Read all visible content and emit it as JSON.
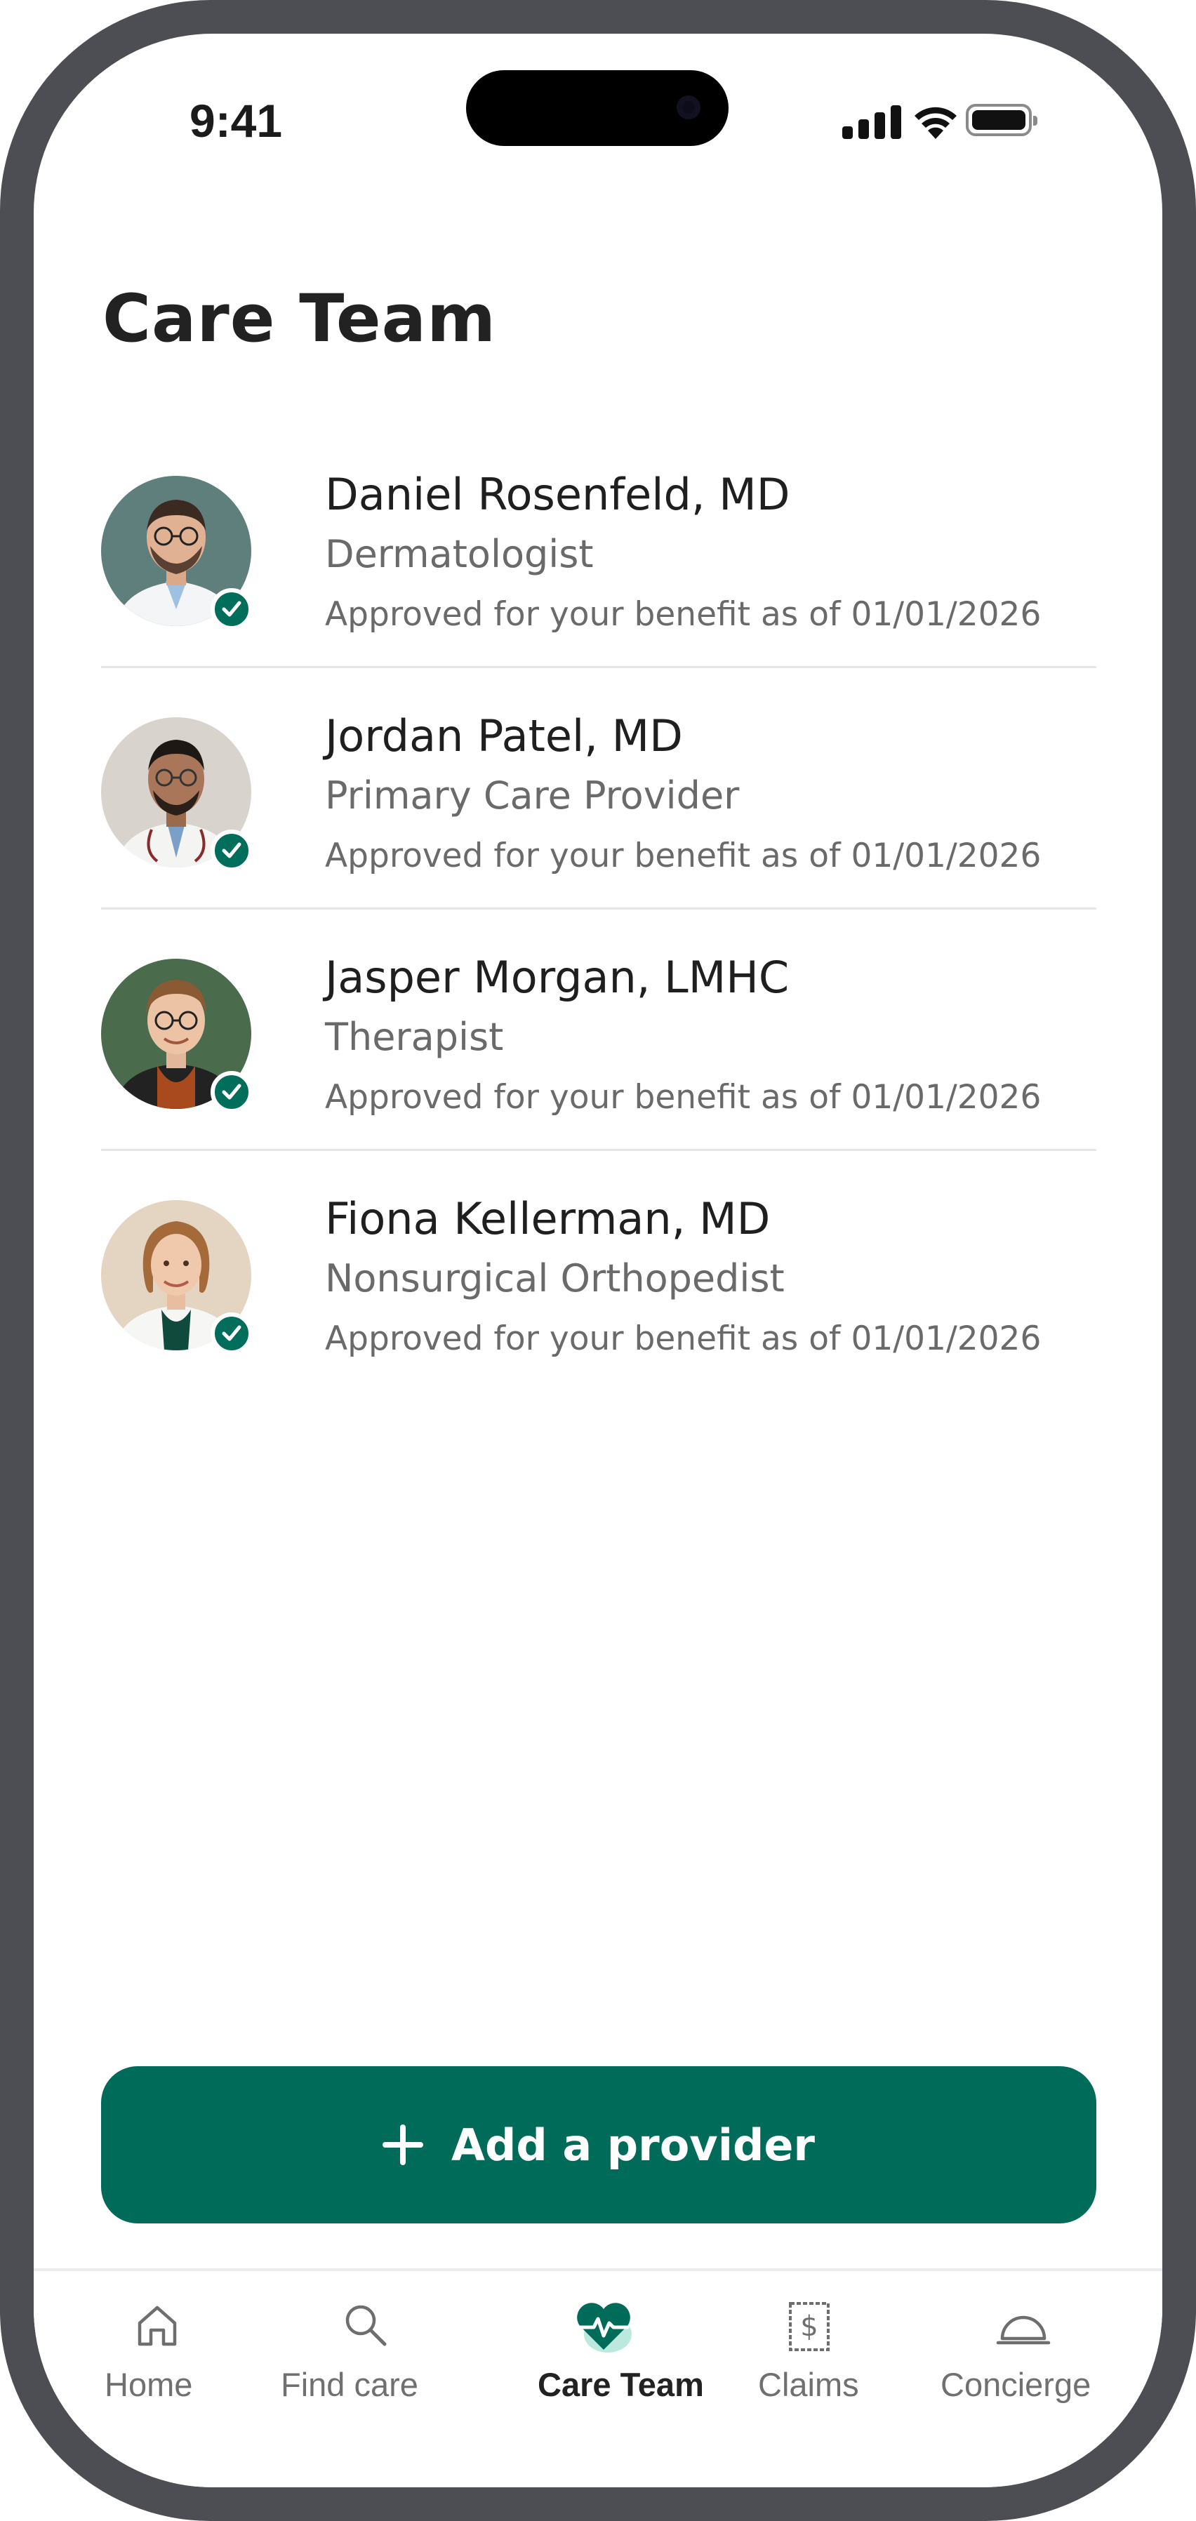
{
  "status_bar": {
    "time": "9:41"
  },
  "page": {
    "title": "Care Team"
  },
  "providers": [
    {
      "name": "Daniel Rosenfeld, MD",
      "specialty": "Dermatologist",
      "approval": "Approved for your benefit as of 01/01/2026"
    },
    {
      "name": "Jordan Patel, MD",
      "specialty": "Primary Care Provider",
      "approval": "Approved for your benefit as of 01/01/2026"
    },
    {
      "name": "Jasper Morgan, LMHC",
      "specialty": "Therapist",
      "approval": "Approved for your benefit as of 01/01/2026"
    },
    {
      "name": "Fiona Kellerman, MD",
      "specialty": "Nonsurgical Orthopedist",
      "approval": "Approved for your benefit as of 01/01/2026"
    }
  ],
  "actions": {
    "add_provider_label": "Add a provider"
  },
  "tabbar": {
    "tabs": [
      {
        "label": "Home",
        "icon": "home-icon",
        "active": false
      },
      {
        "label": "Find care",
        "icon": "search-icon",
        "active": false
      },
      {
        "label": "Care Team",
        "icon": "heart-pulse-icon",
        "active": true
      },
      {
        "label": "Claims",
        "icon": "receipt-dollar-icon",
        "active": false
      },
      {
        "label": "Concierge",
        "icon": "service-bell-icon",
        "active": false
      }
    ]
  },
  "colors": {
    "brand_green": "#006b58",
    "verified_badge": "#006e5a",
    "heart_tint": "#9ee0cf"
  }
}
